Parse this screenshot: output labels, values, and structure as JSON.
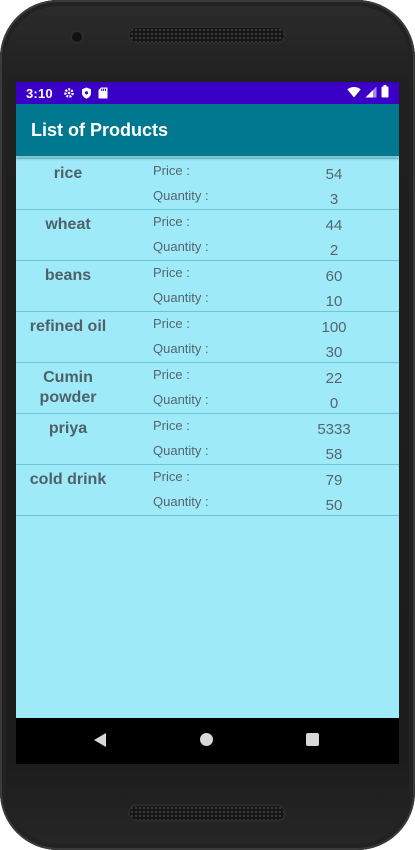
{
  "status": {
    "time": "3:10"
  },
  "app": {
    "title": "List of Products"
  },
  "labels": {
    "price": "Price  :",
    "quantity": "Quantity  :"
  },
  "products": [
    {
      "name": "rice",
      "price": "54",
      "quantity": "3"
    },
    {
      "name": "wheat",
      "price": "44",
      "quantity": "2"
    },
    {
      "name": "beans",
      "price": "60",
      "quantity": "10"
    },
    {
      "name": "refined oil",
      "price": "100",
      "quantity": "30"
    },
    {
      "name": "Cumin powder",
      "price": "22",
      "quantity": "0"
    },
    {
      "name": "priya",
      "price": "5333",
      "quantity": "58"
    },
    {
      "name": "cold drink",
      "price": "79",
      "quantity": "50"
    }
  ],
  "icons": {
    "status_left": [
      "settings-icon",
      "shield-icon",
      "sd-card-icon"
    ],
    "status_right": [
      "wifi-icon",
      "signal-icon",
      "battery-icon"
    ],
    "nav": [
      "back-icon",
      "home-icon",
      "recents-icon"
    ]
  },
  "colors": {
    "status_bar": "#3a00c8",
    "app_bar": "#00788f",
    "list_background": "#9eeaf9"
  }
}
